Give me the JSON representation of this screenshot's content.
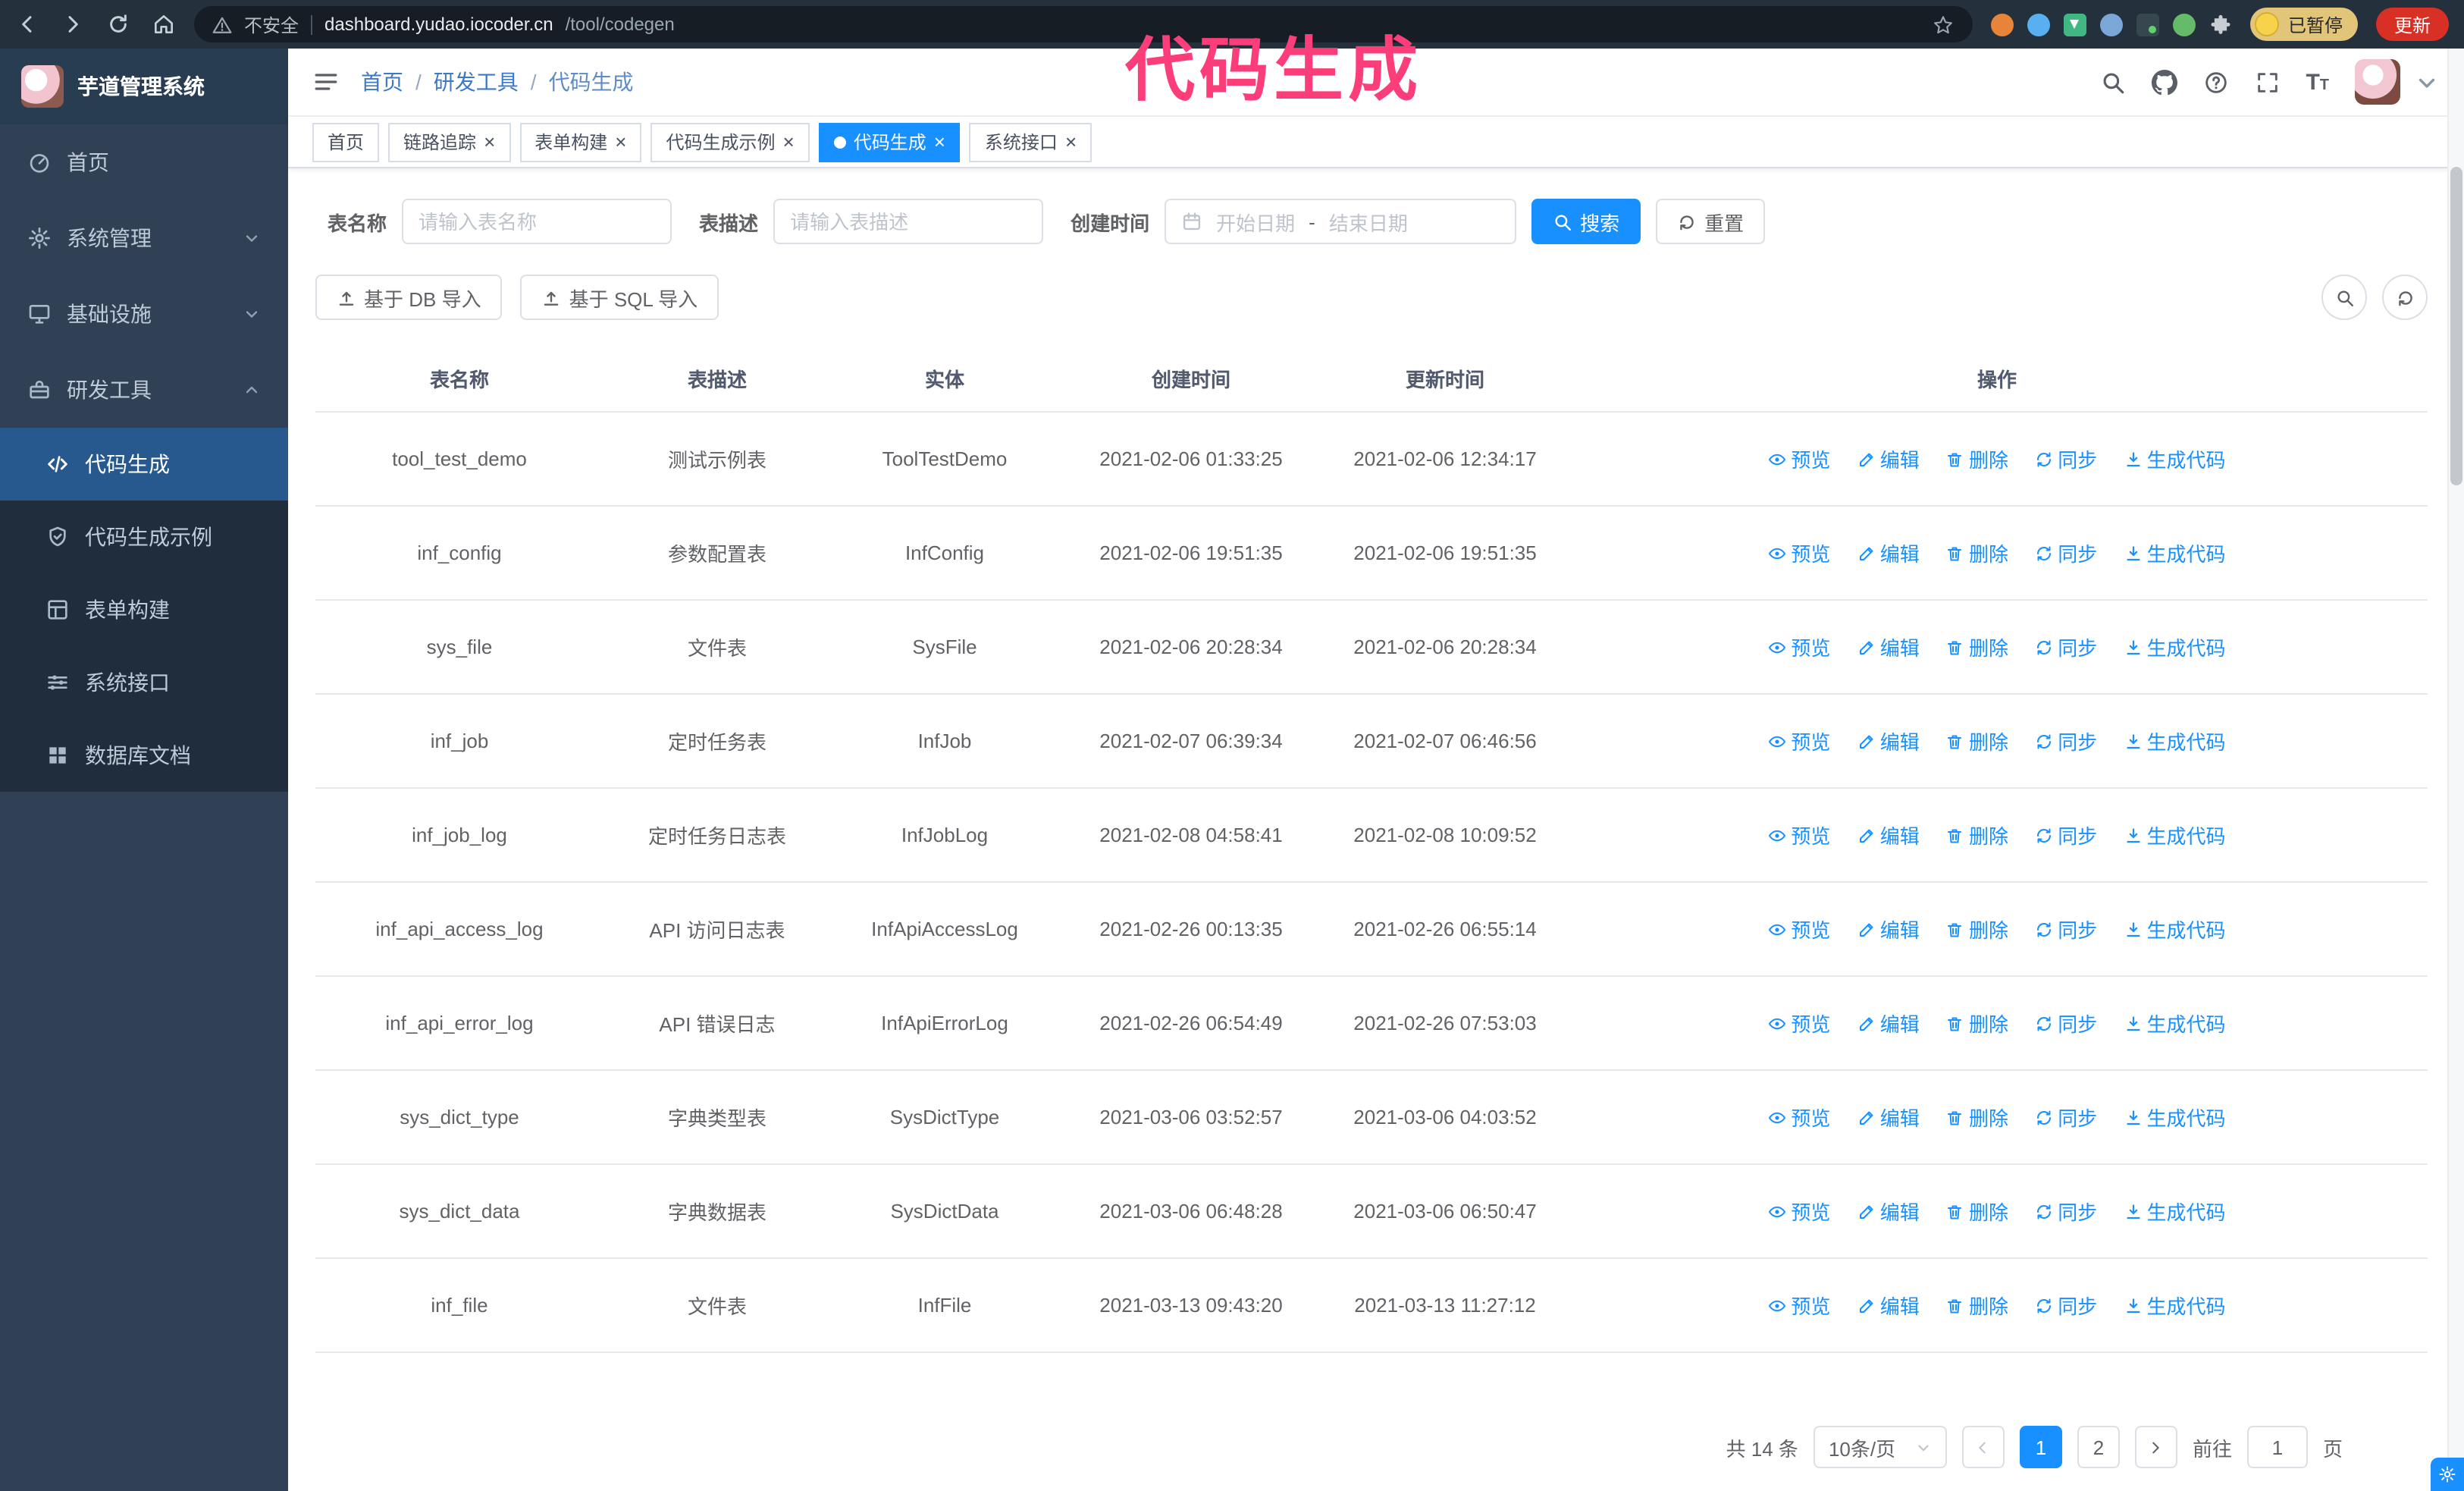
{
  "theme": {
    "accent": "#1890ff",
    "sidebar_bg": "#304156",
    "sidebar_submenu_bg": "#1f2d3d",
    "active_menu_bg": "#27598e",
    "annotation_color": "#fb3e7a",
    "update_chip_bg": "#d93025",
    "paused_chip_bg": "#e2c579"
  },
  "annotation": {
    "text": "代码生成"
  },
  "browser": {
    "security_warning": "不安全",
    "url_host": "dashboard.yudao.iocoder.cn",
    "url_path": "/tool/codegen",
    "profile_chip": "已暂停",
    "update_chip": "更新"
  },
  "sidebar": {
    "logo_title": "芋道管理系统",
    "items": [
      {
        "label": "首页"
      },
      {
        "label": "系统管理"
      },
      {
        "label": "基础设施"
      },
      {
        "label": "研发工具"
      }
    ],
    "subitems": [
      {
        "label": "代码生成"
      },
      {
        "label": "代码生成示例"
      },
      {
        "label": "表单构建"
      },
      {
        "label": "系统接口"
      },
      {
        "label": "数据库文档"
      }
    ]
  },
  "topbar": {
    "breadcrumb": {
      "home": "首页",
      "section": "研发工具",
      "page": "代码生成"
    }
  },
  "tabs": [
    {
      "label": "首页"
    },
    {
      "label": "链路追踪"
    },
    {
      "label": "表单构建"
    },
    {
      "label": "代码生成示例"
    },
    {
      "label": "代码生成"
    },
    {
      "label": "系统接口"
    }
  ],
  "filters": {
    "name_label": "表名称",
    "name_placeholder": "请输入表名称",
    "desc_label": "表描述",
    "desc_placeholder": "请输入表描述",
    "time_label": "创建时间",
    "start_placeholder": "开始日期",
    "range_separator": "-",
    "end_placeholder": "结束日期",
    "search": "搜索",
    "reset": "重置"
  },
  "import_buttons": {
    "db": "基于 DB 导入",
    "sql": "基于 SQL 导入"
  },
  "table": {
    "columns": [
      "表名称",
      "表描述",
      "实体",
      "创建时间",
      "更新时间",
      "操作"
    ],
    "row_actions": {
      "preview": "预览",
      "edit": "编辑",
      "delete": "删除",
      "sync": "同步",
      "generate": "生成代码"
    },
    "rows": [
      {
        "name": "tool_test_demo",
        "desc": "测试示例表",
        "entity": "ToolTestDemo",
        "created": "2021-02-06 01:33:25",
        "updated": "2021-02-06 12:34:17"
      },
      {
        "name": "inf_config",
        "desc": "参数配置表",
        "entity": "InfConfig",
        "created": "2021-02-06 19:51:35",
        "updated": "2021-02-06 19:51:35"
      },
      {
        "name": "sys_file",
        "desc": "文件表",
        "entity": "SysFile",
        "created": "2021-02-06 20:28:34",
        "updated": "2021-02-06 20:28:34"
      },
      {
        "name": "inf_job",
        "desc": "定时任务表",
        "entity": "InfJob",
        "created": "2021-02-07 06:39:34",
        "updated": "2021-02-07 06:46:56"
      },
      {
        "name": "inf_job_log",
        "desc": "定时任务日志表",
        "entity": "InfJobLog",
        "created": "2021-02-08 04:58:41",
        "updated": "2021-02-08 10:09:52"
      },
      {
        "name": "inf_api_access_log",
        "desc": "API 访问日志表",
        "entity": "InfApiAccessLog",
        "created": "2021-02-26 00:13:35",
        "updated": "2021-02-26 06:55:14"
      },
      {
        "name": "inf_api_error_log",
        "desc": "API 错误日志",
        "entity": "InfApiErrorLog",
        "created": "2021-02-26 06:54:49",
        "updated": "2021-02-26 07:53:03"
      },
      {
        "name": "sys_dict_type",
        "desc": "字典类型表",
        "entity": "SysDictType",
        "created": "2021-03-06 03:52:57",
        "updated": "2021-03-06 04:03:52"
      },
      {
        "name": "sys_dict_data",
        "desc": "字典数据表",
        "entity": "SysDictData",
        "created": "2021-03-06 06:48:28",
        "updated": "2021-03-06 06:50:47"
      },
      {
        "name": "inf_file",
        "desc": "文件表",
        "entity": "InfFile",
        "created": "2021-03-13 09:43:20",
        "updated": "2021-03-13 11:27:12"
      }
    ]
  },
  "pagination": {
    "total": "共 14 条",
    "page_size": "10条/页",
    "page1": "1",
    "page2": "2",
    "goto": "前往",
    "goto_value": "1",
    "unit": "页"
  }
}
